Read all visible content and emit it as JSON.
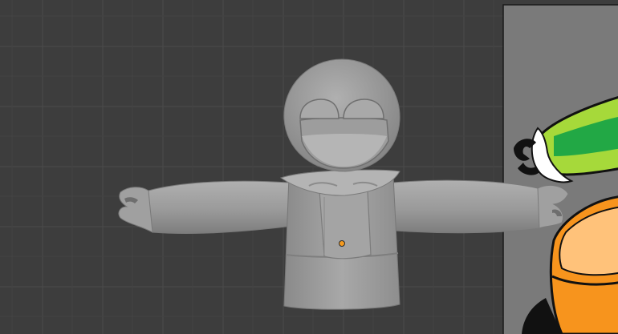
{
  "viewport": {
    "background": "#3d3d3d",
    "grid_color": "#4a4a4a",
    "model_color": "#9d9d9d",
    "origin_color": "#f59a1e"
  },
  "reference_image": {
    "panel_color": "#7a7a7a",
    "accent_colors": [
      "#22a845",
      "#a6d93a",
      "#f7941d",
      "#ffc27a"
    ]
  },
  "icons": {
    "object_origin": "origin-dot-icon"
  }
}
